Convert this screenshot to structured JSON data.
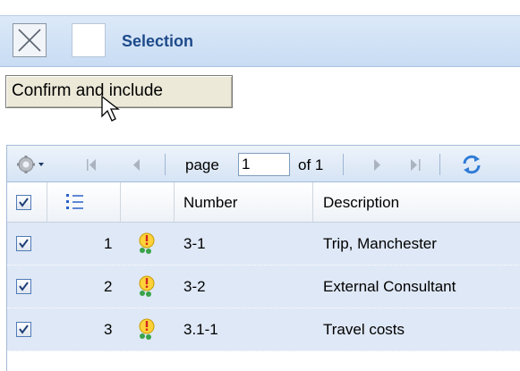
{
  "selection_bar": {
    "title": "Selection",
    "close_icon": "close-x-icon"
  },
  "confirm_button": {
    "label": "Confirm and include"
  },
  "toolbar": {
    "settings_icon": "gear-icon",
    "first_icon": "first-page-icon",
    "prev_icon": "prev-page-icon",
    "page_label": "page",
    "page_value": "1",
    "of_label": "of 1",
    "next_icon": "next-page-icon",
    "last_icon": "last-page-icon",
    "refresh_icon": "refresh-icon"
  },
  "table": {
    "headers": {
      "number": "Number",
      "description": "Description"
    },
    "rows": [
      {
        "index": "1",
        "number": "3-1",
        "description": "Trip, Manchester",
        "checked": true
      },
      {
        "index": "2",
        "number": "3-2",
        "description": "External Consultant",
        "checked": true
      },
      {
        "index": "3",
        "number": "3.1-1",
        "description": "Travel costs",
        "checked": true
      }
    ]
  },
  "colors": {
    "accent_blue": "#1d4a8a",
    "row_bg": "#dfe8f6",
    "toolbar_bg": "#d6e4f4"
  }
}
